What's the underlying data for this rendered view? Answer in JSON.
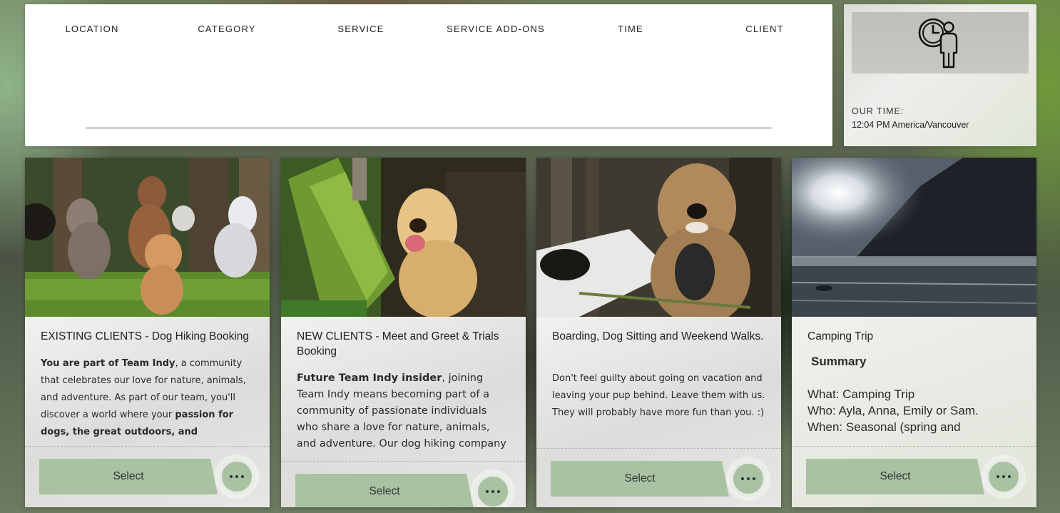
{
  "steps": [
    "LOCATION",
    "CATEGORY",
    "SERVICE",
    "SERVICE ADD-ONS",
    "TIME",
    "CLIENT"
  ],
  "clock": {
    "icon": "clock-person-icon",
    "label": "OUR TIME:",
    "value": "12:04 PM America/Vancouver"
  },
  "cards": [
    {
      "title": "EXISTING CLIENTS - Dog Hiking Booking",
      "desc_bold": "You are part of Team Indy",
      "desc_text": ", a community that celebrates our love for nature, animals, and adventure. As part of our team, you'll discover a world where your ",
      "desc_bold2": "passion for dogs, the great outdoors, and innovation",
      "select_label": "Select"
    },
    {
      "title": "NEW CLIENTS - Meet and Greet & Trials Booking",
      "desc_bold": "Future Team Indy insider",
      "desc_text": ", joining Team Indy means becoming part of a community of passionate individuals who share a love for nature, animals, and adventure. Our dog hiking company not",
      "select_label": "Select"
    },
    {
      "title": "Boarding, Dog Sitting and Weekend Walks.",
      "desc_text": "Don't feel guilty about going on vacation and leaving your pup behind. Leave them with us. They will probably have more fun than you. :)",
      "select_label": "Select"
    },
    {
      "title": "Camping Trip",
      "summary_head": "Summary",
      "summary_lines": [
        "What: Camping Trip",
        "Who: Ayla, Anna, Emily or Sam.",
        "When: Seasonal (spring and"
      ],
      "select_label": "Select"
    }
  ],
  "more_icon": "more-horizontal-icon",
  "colors": {
    "button_green": "#a9c2a2",
    "panel_white": "#ffffff"
  }
}
